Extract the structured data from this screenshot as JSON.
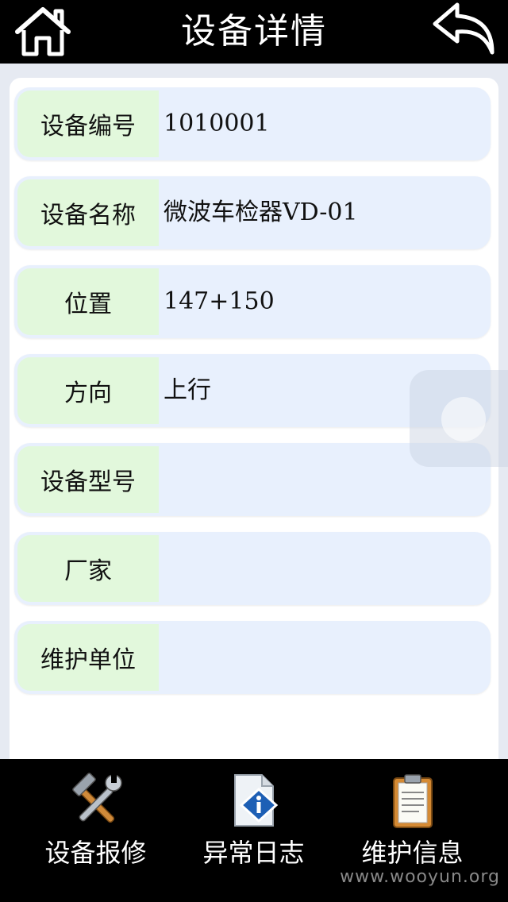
{
  "header": {
    "title": "设备详情",
    "home_icon": "home-icon",
    "back_icon": "back-arrow-icon"
  },
  "details": [
    {
      "label": "设备编号",
      "value": "1010001"
    },
    {
      "label": "设备名称",
      "value": "微波车检器VD-01"
    },
    {
      "label": "位置",
      "value": "147+150"
    },
    {
      "label": "方向",
      "value": "上行"
    },
    {
      "label": "设备型号",
      "value": ""
    },
    {
      "label": "厂家",
      "value": ""
    },
    {
      "label": "维护单位",
      "value": ""
    }
  ],
  "tabs": [
    {
      "label": "设备报修",
      "icon": "tools-icon"
    },
    {
      "label": "异常日志",
      "icon": "info-document-icon"
    },
    {
      "label": "维护信息",
      "icon": "clipboard-icon"
    }
  ],
  "watermark": "www.wooyun.org",
  "colors": {
    "header_bg": "#000000",
    "label_bg": "#e2f8dc",
    "value_bg": "#e8f0fd",
    "content_bg": "#e6eaf2"
  }
}
